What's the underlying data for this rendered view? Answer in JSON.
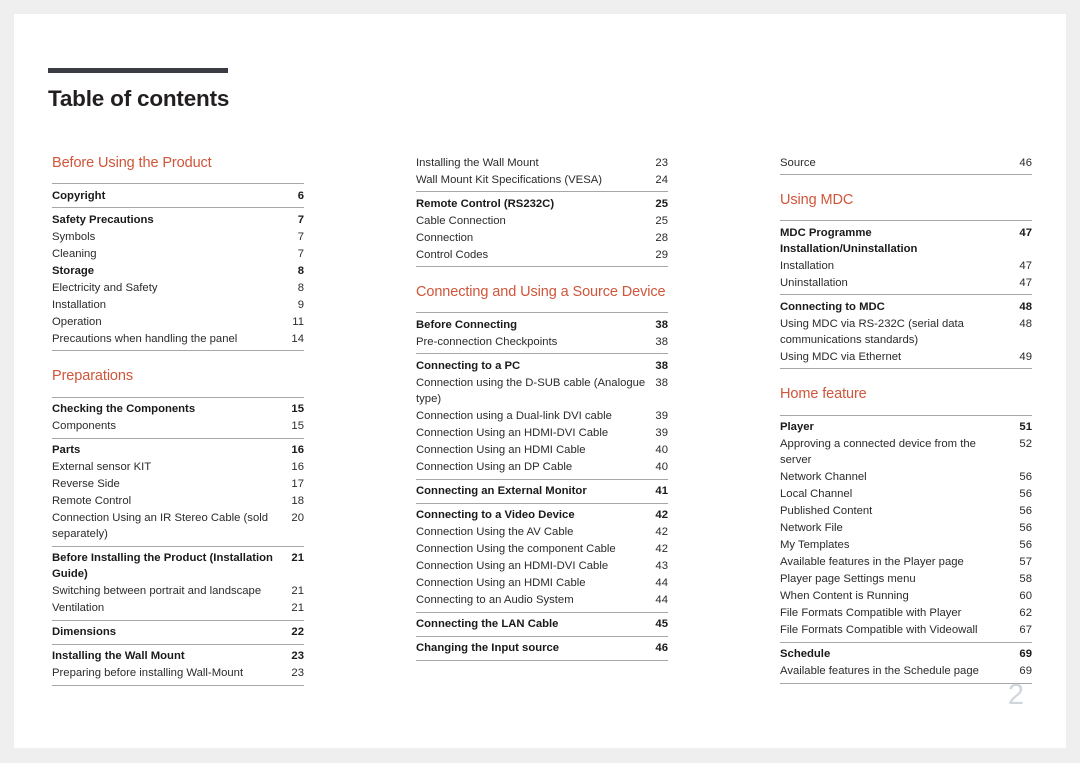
{
  "document": {
    "title": "Table of contents",
    "page_number": "2",
    "accent_color": "#cf563a",
    "rule_color": "#a7a7a7",
    "title_rule_color": "#3b3b44"
  },
  "columns": [
    {
      "name": "column-1",
      "sections": [
        {
          "heading": "Before Using the Product",
          "groups": [
            {
              "entries": [
                {
                  "label": "Copyright",
                  "page": "6",
                  "chapter": true
                }
              ]
            },
            {
              "entries": [
                {
                  "label": "Safety Precautions",
                  "page": "7",
                  "chapter": true
                },
                {
                  "label": "Symbols",
                  "page": "7",
                  "chapter": false
                },
                {
                  "label": "Cleaning",
                  "page": "7",
                  "chapter": false
                },
                {
                  "label": "Storage",
                  "page": "8",
                  "chapter": true
                },
                {
                  "label": "Electricity and Safety",
                  "page": "8",
                  "chapter": false
                },
                {
                  "label": "Installation",
                  "page": "9",
                  "chapter": false
                },
                {
                  "label": "Operation",
                  "page": "11",
                  "chapter": false
                },
                {
                  "label": "Precautions when handling the panel",
                  "page": "14",
                  "chapter": false
                }
              ]
            }
          ]
        },
        {
          "heading": "Preparations",
          "groups": [
            {
              "entries": [
                {
                  "label": "Checking the Components",
                  "page": "15",
                  "chapter": true
                },
                {
                  "label": "Components",
                  "page": "15",
                  "chapter": false
                }
              ]
            },
            {
              "entries": [
                {
                  "label": "Parts",
                  "page": "16",
                  "chapter": true
                },
                {
                  "label": "External sensor KIT",
                  "page": "16",
                  "chapter": false
                },
                {
                  "label": "Reverse Side",
                  "page": "17",
                  "chapter": false
                },
                {
                  "label": "Remote Control",
                  "page": "18",
                  "chapter": false
                },
                {
                  "label": "Connection Using an IR Stereo Cable (sold separately)",
                  "page": "20",
                  "chapter": false
                }
              ]
            },
            {
              "entries": [
                {
                  "label": "Before Installing the Product (Installation Guide)",
                  "page": "21",
                  "chapter": true
                },
                {
                  "label": "Switching between portrait and landscape",
                  "page": "21",
                  "chapter": false
                },
                {
                  "label": "Ventilation",
                  "page": "21",
                  "chapter": false
                }
              ]
            },
            {
              "entries": [
                {
                  "label": "Dimensions",
                  "page": "22",
                  "chapter": true
                }
              ]
            },
            {
              "entries": [
                {
                  "label": "Installing the Wall Mount",
                  "page": "23",
                  "chapter": true
                },
                {
                  "label": "Preparing before installing Wall-Mount",
                  "page": "23",
                  "chapter": false
                }
              ]
            }
          ]
        }
      ]
    },
    {
      "name": "column-2",
      "sections": [
        {
          "heading": "",
          "groups": [
            {
              "no_rule": true,
              "entries": [
                {
                  "label": "Installing the Wall Mount",
                  "page": "23",
                  "chapter": false
                },
                {
                  "label": "Wall Mount Kit Specifications (VESA)",
                  "page": "24",
                  "chapter": false
                }
              ]
            },
            {
              "entries": [
                {
                  "label": "Remote Control (RS232C)",
                  "page": "25",
                  "chapter": true
                },
                {
                  "label": "Cable Connection",
                  "page": "25",
                  "chapter": false
                },
                {
                  "label": "Connection",
                  "page": "28",
                  "chapter": false
                },
                {
                  "label": "Control Codes",
                  "page": "29",
                  "chapter": false
                }
              ]
            }
          ]
        },
        {
          "heading": "Connecting and Using a Source Device",
          "groups": [
            {
              "entries": [
                {
                  "label": "Before Connecting",
                  "page": "38",
                  "chapter": true
                },
                {
                  "label": "Pre-connection Checkpoints",
                  "page": "38",
                  "chapter": false
                }
              ]
            },
            {
              "entries": [
                {
                  "label": "Connecting to a PC",
                  "page": "38",
                  "chapter": true
                },
                {
                  "label": "Connection using the D-SUB cable (Analogue type)",
                  "page": "38",
                  "chapter": false
                },
                {
                  "label": "Connection using a Dual-link DVI cable",
                  "page": "39",
                  "chapter": false
                },
                {
                  "label": "Connection Using an HDMI-DVI Cable",
                  "page": "39",
                  "chapter": false
                },
                {
                  "label": "Connection Using an HDMI Cable",
                  "page": "40",
                  "chapter": false
                },
                {
                  "label": "Connection Using an DP Cable",
                  "page": "40",
                  "chapter": false
                }
              ]
            },
            {
              "entries": [
                {
                  "label": "Connecting an External Monitor",
                  "page": "41",
                  "chapter": true
                }
              ]
            },
            {
              "entries": [
                {
                  "label": "Connecting to a Video Device",
                  "page": "42",
                  "chapter": true
                },
                {
                  "label": "Connection Using the AV Cable",
                  "page": "42",
                  "chapter": false
                },
                {
                  "label": "Connection Using the component Cable",
                  "page": "42",
                  "chapter": false
                },
                {
                  "label": "Connection Using an HDMI-DVI Cable",
                  "page": "43",
                  "chapter": false
                },
                {
                  "label": "Connection Using an HDMI Cable",
                  "page": "44",
                  "chapter": false
                },
                {
                  "label": "Connecting to an Audio System",
                  "page": "44",
                  "chapter": false
                }
              ]
            },
            {
              "entries": [
                {
                  "label": "Connecting the LAN Cable",
                  "page": "45",
                  "chapter": true
                }
              ]
            },
            {
              "entries": [
                {
                  "label": "Changing the Input source",
                  "page": "46",
                  "chapter": true
                }
              ]
            }
          ]
        }
      ]
    },
    {
      "name": "column-3",
      "sections": [
        {
          "heading": "",
          "groups": [
            {
              "no_rule": true,
              "entries": [
                {
                  "label": "Source",
                  "page": "46",
                  "chapter": false
                }
              ]
            }
          ]
        },
        {
          "heading": "Using MDC",
          "groups": [
            {
              "entries": [
                {
                  "label": "MDC Programme Installation/Uninstallation",
                  "page": "47",
                  "chapter": true
                },
                {
                  "label": "Installation",
                  "page": "47",
                  "chapter": false
                },
                {
                  "label": "Uninstallation",
                  "page": "47",
                  "chapter": false
                }
              ]
            },
            {
              "entries": [
                {
                  "label": "Connecting to MDC",
                  "page": "48",
                  "chapter": true
                },
                {
                  "label": "Using MDC via RS-232C (serial data communications standards)",
                  "page": "48",
                  "chapter": false
                },
                {
                  "label": "Using MDC via Ethernet",
                  "page": "49",
                  "chapter": false
                }
              ]
            }
          ]
        },
        {
          "heading": "Home feature",
          "groups": [
            {
              "entries": [
                {
                  "label": "Player",
                  "page": "51",
                  "chapter": true
                },
                {
                  "label": "Approving a connected device from the server",
                  "page": "52",
                  "chapter": false
                },
                {
                  "label": "Network Channel",
                  "page": "56",
                  "chapter": false
                },
                {
                  "label": "Local Channel",
                  "page": "56",
                  "chapter": false
                },
                {
                  "label": "Published Content",
                  "page": "56",
                  "chapter": false
                },
                {
                  "label": "Network File",
                  "page": "56",
                  "chapter": false
                },
                {
                  "label": "My Templates",
                  "page": "56",
                  "chapter": false
                },
                {
                  "label": "Available features in the Player page",
                  "page": "57",
                  "chapter": false
                },
                {
                  "label": "Player page Settings menu",
                  "page": "58",
                  "chapter": false
                },
                {
                  "label": "When Content is Running",
                  "page": "60",
                  "chapter": false
                },
                {
                  "label": "File Formats Compatible with Player",
                  "page": "62",
                  "chapter": false
                },
                {
                  "label": "File Formats Compatible with Videowall",
                  "page": "67",
                  "chapter": false
                }
              ]
            },
            {
              "entries": [
                {
                  "label": "Schedule",
                  "page": "69",
                  "chapter": true
                },
                {
                  "label": "Available features in the Schedule page",
                  "page": "69",
                  "chapter": false
                }
              ]
            }
          ]
        }
      ]
    }
  ]
}
